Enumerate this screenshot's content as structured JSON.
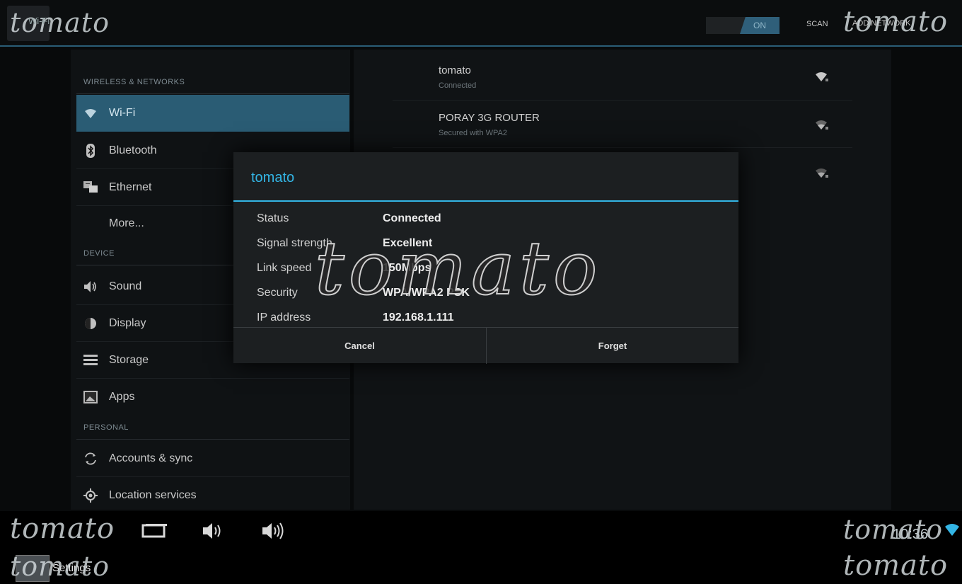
{
  "action_bar": {
    "title": "Wi-Fi",
    "watermark": "tomato",
    "toggle_label": "ON",
    "scan_label": "SCAN",
    "add_network_label": "ADD NETWORK"
  },
  "sidebar": {
    "categories": [
      "WIRELESS & NETWORKS",
      "DEVICE",
      "PERSONAL"
    ],
    "items": [
      {
        "label": "Wi-Fi",
        "icon": "wifi-icon",
        "selected": true
      },
      {
        "label": "Bluetooth",
        "icon": "bluetooth-icon"
      },
      {
        "label": "Ethernet",
        "icon": "ethernet-icon"
      },
      {
        "label": "More...",
        "icon": ""
      },
      {
        "label": "Sound",
        "icon": "speaker-icon"
      },
      {
        "label": "Display",
        "icon": "display-icon"
      },
      {
        "label": "Storage",
        "icon": "storage-icon"
      },
      {
        "label": "Apps",
        "icon": "apps-icon"
      },
      {
        "label": "Accounts & sync",
        "icon": "sync-icon"
      },
      {
        "label": "Location services",
        "icon": "location-icon"
      }
    ]
  },
  "networks": [
    {
      "name": "tomato",
      "status": "Connected"
    },
    {
      "name": "PORAY 3G ROUTER",
      "status": "Secured with WPA2"
    },
    {
      "name": "",
      "status": ""
    }
  ],
  "dialog": {
    "title": "tomato",
    "rows": [
      {
        "label": "Status",
        "value": "Connected"
      },
      {
        "label": "Signal strength",
        "value": "Excellent"
      },
      {
        "label": "Link speed",
        "value": "150Mbps"
      },
      {
        "label": "Security",
        "value": "WPA/WPA2 PSK"
      },
      {
        "label": "IP address",
        "value": "192.168.1.111"
      }
    ],
    "cancel_label": "Cancel",
    "forget_label": "Forget",
    "watermark": "tomato"
  },
  "navbar": {
    "watermark": "tomato",
    "clock": "10:36",
    "settings_label": "Settings"
  },
  "colors": {
    "accent": "#33b5e5",
    "selected": "#2a5c74"
  }
}
